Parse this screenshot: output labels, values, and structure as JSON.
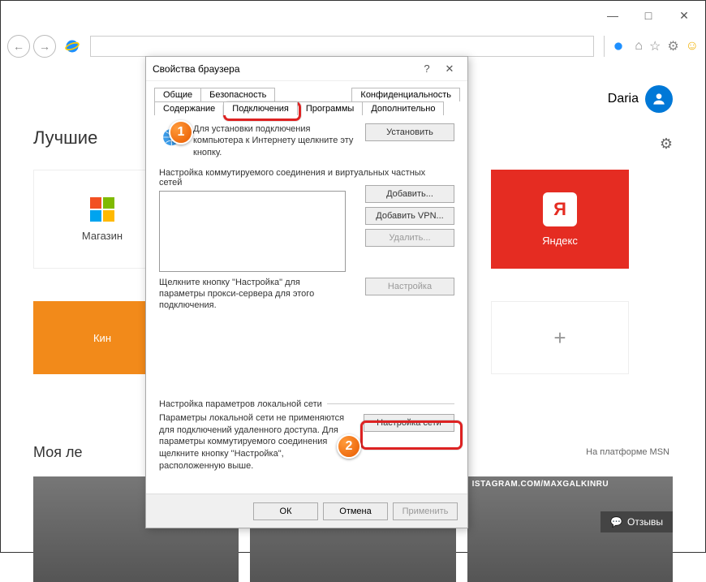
{
  "window": {
    "min": "—",
    "max": "□",
    "close": "✕"
  },
  "toolbar": {
    "back": "←",
    "fwd": "→",
    "home": "⌂",
    "star": "☆",
    "gear": "⚙",
    "smile": "☺"
  },
  "user": {
    "name": "Daria"
  },
  "headings": {
    "best": "Лучшие",
    "feed": "Моя ле"
  },
  "tiles": {
    "store": "Магазин",
    "kino": "Кин",
    "yandex": "Яндекс",
    "ya_glyph": "Я"
  },
  "msn": "На платформе MSN",
  "insta": "ISTAGRAM.COM/MAXGALKINRU",
  "feedback": "Отзывы",
  "dialog": {
    "title": "Свойства браузера",
    "help": "?",
    "close": "✕",
    "tabs_row1": [
      "Общие",
      "Безопасность",
      "Конфиденциальность"
    ],
    "tabs_row2": [
      "Содержание",
      "Подключения",
      "Программы",
      "Дополнительно"
    ],
    "setup_text": "Для установки подключения компьютера к Интернету щелкните эту кнопку.",
    "btn_setup": "Установить",
    "group_dial": "Настройка коммутируемого соединения и виртуальных частных сетей",
    "btn_add": "Добавить...",
    "btn_addvpn": "Добавить VPN...",
    "btn_del": "Удалить...",
    "btn_cfg": "Настройка",
    "hint_proxy": "Щелкните кнопку \"Настройка\" для параметры прокси-сервера для этого подключения.",
    "group_lan": "Настройка параметров локальной сети",
    "lan_text": "Параметры локальной сети не применяются для подключений удаленного доступа. Для параметры коммутируемого соединения щелкните кнопку \"Настройка\", расположенную выше.",
    "btn_lan": "Настройка сети",
    "ok": "ОК",
    "cancel": "Отмена",
    "apply": "Применить"
  },
  "badges": {
    "one": "1",
    "two": "2"
  }
}
